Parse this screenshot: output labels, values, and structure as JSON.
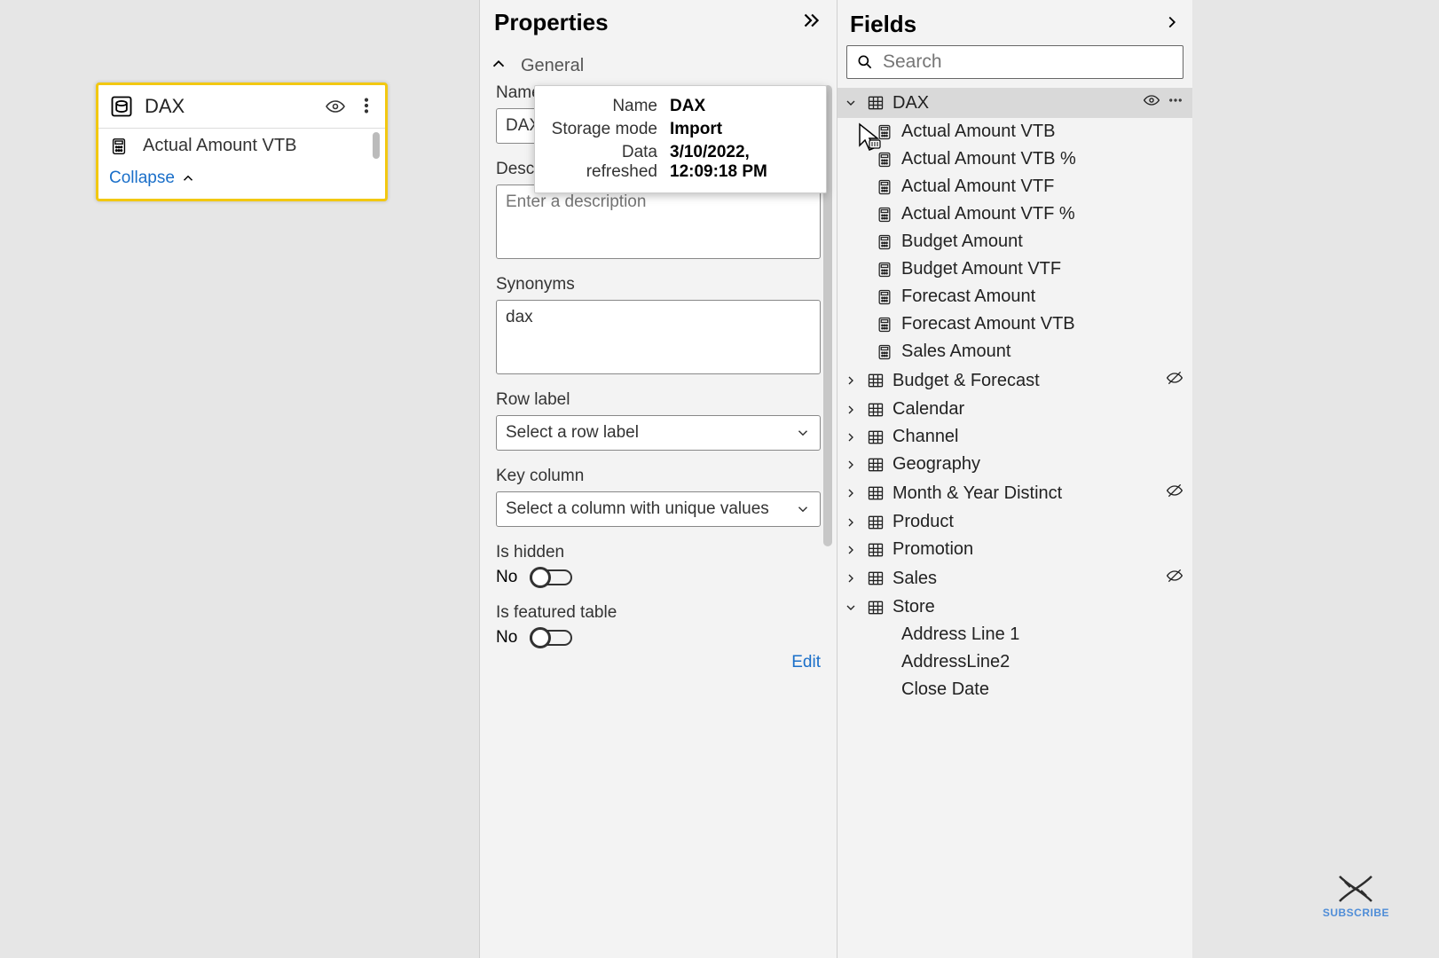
{
  "canvas": {
    "card": {
      "title": "DAX",
      "field": "Actual Amount VTB",
      "collapse": "Collapse"
    }
  },
  "properties": {
    "title": "Properties",
    "section_general": "General",
    "name_label": "Name",
    "name_value": "DAX",
    "description_label": "Description",
    "description_placeholder": "Enter a description",
    "synonyms_label": "Synonyms",
    "synonyms_value": "dax",
    "row_label_label": "Row label",
    "row_label_placeholder": "Select a row label",
    "key_column_label": "Key column",
    "key_column_placeholder": "Select a column with unique values",
    "is_hidden_label": "Is hidden",
    "toggle_no": "No",
    "is_featured_label": "Is featured table",
    "edit": "Edit"
  },
  "tooltip": {
    "k1": "Name",
    "v1": "DAX",
    "k2": "Storage mode",
    "v2": "Import",
    "k3": "Data refreshed",
    "v3": "3/10/2022, 12:09:18 PM"
  },
  "fields": {
    "title": "Fields",
    "search_placeholder": "Search",
    "tables": [
      {
        "name": "DAX",
        "expanded": true,
        "selected": true,
        "kind": "calc-table",
        "show_eye": true,
        "children": [
          {
            "name": "Actual Amount VTB",
            "kind": "measure"
          },
          {
            "name": "Actual Amount VTB %",
            "kind": "measure"
          },
          {
            "name": "Actual Amount VTF",
            "kind": "measure"
          },
          {
            "name": "Actual Amount VTF %",
            "kind": "measure"
          },
          {
            "name": "Budget Amount",
            "kind": "measure"
          },
          {
            "name": "Budget Amount VTF",
            "kind": "measure"
          },
          {
            "name": "Forecast Amount",
            "kind": "measure"
          },
          {
            "name": "Forecast Amount VTB",
            "kind": "measure"
          },
          {
            "name": "Sales Amount",
            "kind": "measure"
          }
        ]
      },
      {
        "name": "Budget & Forecast",
        "expanded": false,
        "kind": "table",
        "hidden_hint": true
      },
      {
        "name": "Calendar",
        "expanded": false,
        "kind": "table"
      },
      {
        "name": "Channel",
        "expanded": false,
        "kind": "table"
      },
      {
        "name": "Geography",
        "expanded": false,
        "kind": "table"
      },
      {
        "name": "Month & Year Distinct",
        "expanded": false,
        "kind": "table",
        "hidden_hint": true
      },
      {
        "name": "Product",
        "expanded": false,
        "kind": "table"
      },
      {
        "name": "Promotion",
        "expanded": false,
        "kind": "table"
      },
      {
        "name": "Sales",
        "expanded": false,
        "kind": "table",
        "hidden_hint": true
      },
      {
        "name": "Store",
        "expanded": true,
        "kind": "table",
        "children": [
          {
            "name": "Address Line 1",
            "kind": "column"
          },
          {
            "name": "AddressLine2",
            "kind": "column"
          },
          {
            "name": "Close Date",
            "kind": "column"
          }
        ]
      }
    ]
  },
  "subscribe": "SUBSCRIBE"
}
